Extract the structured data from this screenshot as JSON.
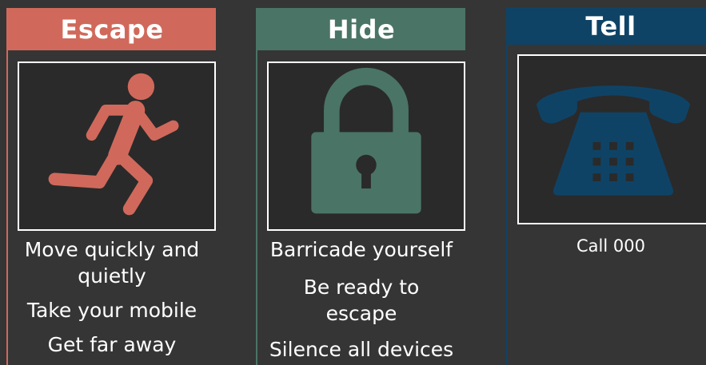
{
  "colors": {
    "escape": "#d0695b",
    "hide": "#4a7466",
    "tell": "#0f4366",
    "background": "#353535",
    "frame": "#ffffff",
    "text": "#ffffff"
  },
  "panels": [
    {
      "id": "escape",
      "title": "Escape",
      "icon": "running-person-icon",
      "lines": [
        "Move quickly and quietly",
        "Take your mobile",
        "Get far away"
      ]
    },
    {
      "id": "hide",
      "title": "Hide",
      "icon": "padlock-icon",
      "lines": [
        "Barricade yourself",
        "Be ready to escape",
        "Silence all devices"
      ]
    },
    {
      "id": "tell",
      "title": "Tell",
      "icon": "telephone-icon",
      "lines": [
        "Call 000"
      ]
    }
  ]
}
